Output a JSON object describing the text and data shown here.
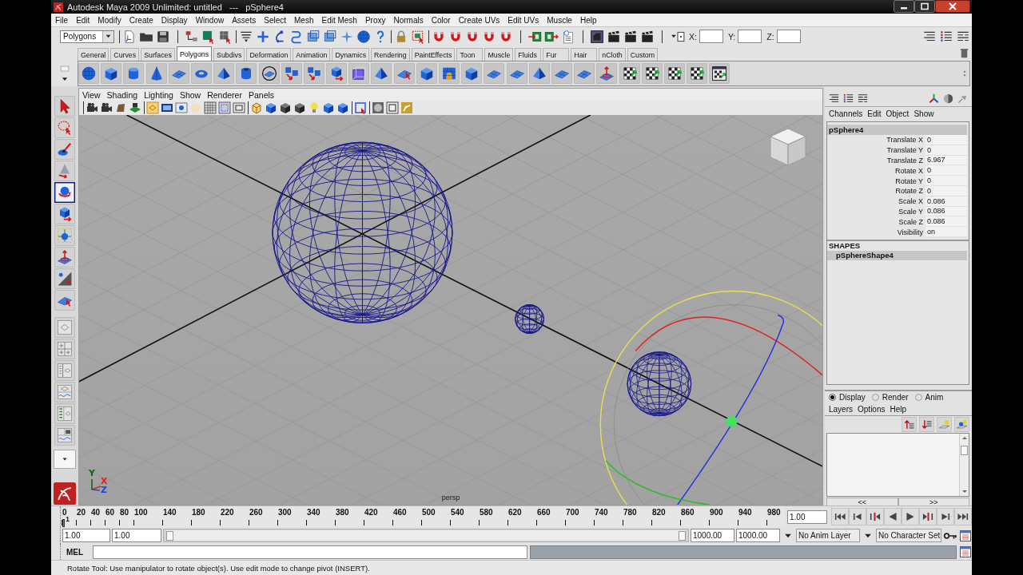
{
  "window": {
    "title": "Autodesk Maya 2009 Unlimited: untitled   ---   pSphere4"
  },
  "menu_bar": [
    "File",
    "Edit",
    "Modify",
    "Create",
    "Display",
    "Window",
    "Assets",
    "Select",
    "Mesh",
    "Edit Mesh",
    "Proxy",
    "Normals",
    "Color",
    "Create UVs",
    "Edit UVs",
    "Muscle",
    "Help"
  ],
  "status_line": {
    "menu_set": "Polygons",
    "coordinate_labels": [
      "X:",
      "Y:",
      "Z:"
    ]
  },
  "shelf": {
    "tabs": [
      {
        "label": "General",
        "selected": false
      },
      {
        "label": "Curves",
        "selected": false
      },
      {
        "label": "Surfaces",
        "selected": false
      },
      {
        "label": "Polygons",
        "selected": true
      },
      {
        "label": "Subdivs",
        "selected": false
      },
      {
        "label": "Deformation",
        "selected": false
      },
      {
        "label": "Animation",
        "selected": false
      },
      {
        "label": "Dynamics",
        "selected": false
      },
      {
        "label": "Rendering",
        "selected": false
      },
      {
        "label": "PaintEffects",
        "selected": false
      },
      {
        "label": "Toon",
        "selected": false
      },
      {
        "label": "Muscle",
        "selected": false
      },
      {
        "label": "Fluids",
        "selected": false
      },
      {
        "label": "Fur",
        "selected": false
      },
      {
        "label": "Hair",
        "selected": false
      },
      {
        "label": "nCloth",
        "selected": false
      },
      {
        "label": "Custom",
        "selected": false
      }
    ]
  },
  "toolbox": {
    "tools": [
      {
        "selected": false
      },
      {
        "selected": false
      },
      {
        "selected": false
      },
      {
        "selected": false
      },
      {
        "selected": true
      },
      {
        "selected": false
      },
      {
        "selected": false
      },
      {
        "selected": false
      },
      {
        "selected": false
      },
      {
        "selected": false
      }
    ]
  },
  "viewport": {
    "menu": [
      "View",
      "Shading",
      "Lighting",
      "Show",
      "Renderer",
      "Panels"
    ],
    "camera": "persp",
    "axis_gizmo": [
      {
        "label": "Y",
        "color": "#0a6a0a"
      },
      {
        "label": "X",
        "color": "#e02222"
      },
      {
        "label": "Z",
        "color": "#2244dd"
      }
    ]
  },
  "channel_box": {
    "menu": [
      "Channels",
      "Edit",
      "Object",
      "Show"
    ],
    "object": "pSphere4",
    "channels": [
      {
        "name": "Translate X",
        "value": "0"
      },
      {
        "name": "Translate Y",
        "value": "0"
      },
      {
        "name": "Translate Z",
        "value": "6.967"
      },
      {
        "name": "Rotate X",
        "value": "0"
      },
      {
        "name": "Rotate Y",
        "value": "0"
      },
      {
        "name": "Rotate Z",
        "value": "0"
      },
      {
        "name": "Scale X",
        "value": "0.086"
      },
      {
        "name": "Scale Y",
        "value": "0.086"
      },
      {
        "name": "Scale Z",
        "value": "0.086"
      },
      {
        "name": "Visibility",
        "value": "on"
      }
    ],
    "shapes_heading": "SHAPES",
    "shapes": [
      {
        "name": "pSphereShape4",
        "selected": true
      }
    ]
  },
  "layer_editor": {
    "modes": [
      {
        "label": "Display",
        "selected": true
      },
      {
        "label": "Render",
        "selected": false
      },
      {
        "label": "Anim",
        "selected": false
      }
    ],
    "menu": [
      "Layers",
      "Options",
      "Help"
    ],
    "nav_buttons": [
      "<<",
      ">>"
    ]
  },
  "time_slider": {
    "ticks": [
      "0",
      "20",
      "40",
      "60",
      "80",
      "100",
      "140",
      "180",
      "220",
      "260",
      "300",
      "340",
      "380",
      "420",
      "460",
      "500",
      "540",
      "580",
      "620",
      "660",
      "700",
      "740",
      "780",
      "820",
      "860",
      "900",
      "940",
      "980"
    ],
    "level": 0.001,
    "marker_label": "1",
    "current_frame": "1.00"
  },
  "range_slider": {
    "start_time": "1.00",
    "playback_start": "1.00",
    "level": 1,
    "playback_end": "1000.00",
    "end_time": "1000.00",
    "anim_layer": "No Anim Layer",
    "character_set": "No Character Set"
  },
  "command_line": {
    "label": "MEL"
  },
  "help_line": "Rotate Tool: Use manipulator to rotate object(s). Use edit mode to change pivot (INSERT)."
}
